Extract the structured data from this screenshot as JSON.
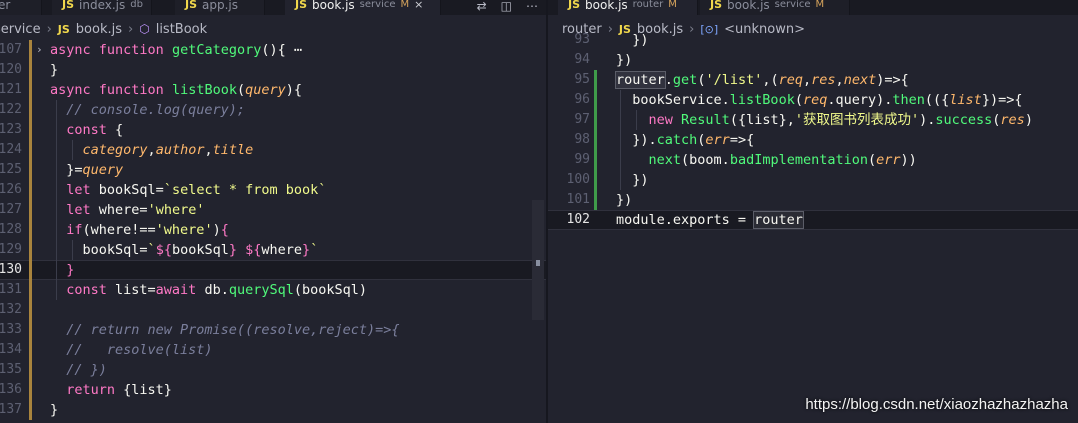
{
  "left_pane": {
    "tabs": [
      {
        "icon": "",
        "name": "er",
        "desc": "",
        "mod": ""
      },
      {
        "icon": "JS",
        "name": "index.js",
        "desc": "db",
        "mod": ""
      },
      {
        "icon": "JS",
        "name": "app.js",
        "desc": "",
        "mod": ""
      },
      {
        "icon": "JS",
        "name": "book.js",
        "desc": "service",
        "mod": "M"
      }
    ],
    "close_glyph": "×",
    "actions": [
      "⇄",
      "◫",
      "⋯"
    ],
    "breadcrumb": {
      "folder": "service",
      "js": "JS",
      "file": "book.js",
      "symbol": "listBook"
    },
    "lines": [
      {
        "num": "107",
        "parts": [
          [
            "kw",
            "async "
          ],
          [
            "kw",
            "function "
          ],
          [
            "fn",
            "getCategory"
          ],
          [
            "pl",
            "(){ "
          ],
          [
            "pl",
            "⋯"
          ]
        ]
      },
      {
        "num": "120",
        "parts": [
          [
            "pl",
            "}"
          ]
        ]
      },
      {
        "num": "121",
        "parts": [
          [
            "kw",
            "async "
          ],
          [
            "kw",
            "function "
          ],
          [
            "fn",
            "listBook"
          ],
          [
            "pl",
            "("
          ],
          [
            "prm",
            "query"
          ],
          [
            "pl",
            "){"
          ]
        ]
      },
      {
        "num": "122",
        "parts": [
          [
            "cm",
            "  // console.log(query);"
          ]
        ]
      },
      {
        "num": "123",
        "parts": [
          [
            "kw",
            "  const "
          ],
          [
            "pl",
            "{"
          ]
        ]
      },
      {
        "num": "124",
        "parts": [
          [
            "prm",
            "    category"
          ],
          [
            "pl",
            ","
          ],
          [
            "prm",
            "author"
          ],
          [
            "pl",
            ","
          ],
          [
            "prm",
            "title"
          ]
        ]
      },
      {
        "num": "125",
        "parts": [
          [
            "pl",
            "  }="
          ],
          [
            "prm",
            "query"
          ]
        ]
      },
      {
        "num": "126",
        "parts": [
          [
            "kw",
            "  let "
          ],
          [
            "pl",
            "bookSql="
          ],
          [
            "str",
            "`select * from book`"
          ]
        ]
      },
      {
        "num": "127",
        "parts": [
          [
            "kw",
            "  let "
          ],
          [
            "pl",
            "where="
          ],
          [
            "str",
            "'where'"
          ]
        ]
      },
      {
        "num": "128",
        "parts": [
          [
            "kw",
            "  if"
          ],
          [
            "pl",
            "(where!=="
          ],
          [
            "str",
            "'where'"
          ],
          [
            "pl",
            ")"
          ],
          [
            "kw",
            "{"
          ]
        ]
      },
      {
        "num": "129",
        "parts": [
          [
            "pl",
            "    bookSql="
          ],
          [
            "str",
            "`"
          ],
          [
            "kw",
            "${"
          ],
          [
            "pl",
            "bookSql"
          ],
          [
            "kw",
            "}"
          ],
          [
            "str",
            " "
          ],
          [
            "kw",
            "${"
          ],
          [
            "pl",
            "where"
          ],
          [
            "kw",
            "}"
          ],
          [
            "str",
            "`"
          ]
        ]
      },
      {
        "num": "130",
        "parts": [
          [
            "kw",
            "  }"
          ]
        ]
      },
      {
        "num": "131",
        "parts": [
          [
            "kw",
            "  const "
          ],
          [
            "pl",
            "list="
          ],
          [
            "kw",
            "await "
          ],
          [
            "pl",
            "db."
          ],
          [
            "fn",
            "querySql"
          ],
          [
            "pl",
            "(bookSql)"
          ]
        ]
      },
      {
        "num": "132",
        "parts": []
      },
      {
        "num": "133",
        "parts": [
          [
            "cm",
            "  // return new Promise((resolve,reject)=>{"
          ]
        ]
      },
      {
        "num": "134",
        "parts": [
          [
            "cm",
            "  //   resolve(list)"
          ]
        ]
      },
      {
        "num": "135",
        "parts": [
          [
            "cm",
            "  // })"
          ]
        ]
      },
      {
        "num": "136",
        "parts": [
          [
            "kw",
            "  return "
          ],
          [
            "pl",
            "{list}"
          ]
        ]
      },
      {
        "num": "137",
        "parts": [
          [
            "pl",
            "}"
          ]
        ]
      }
    ]
  },
  "right_pane": {
    "tabs": [
      {
        "icon": "JS",
        "name": "book.js",
        "desc": "router",
        "mod": "M"
      },
      {
        "icon": "JS",
        "name": "book.js",
        "desc": "service",
        "mod": "M"
      }
    ],
    "breadcrumb": {
      "folder": "router",
      "js": "JS",
      "file": "book.js",
      "symbol": "<unknown>"
    },
    "lines": [
      {
        "num": "93",
        "parts": [
          [
            "pl",
            "  })"
          ]
        ]
      },
      {
        "num": "94",
        "parts": [
          [
            "pl",
            "})"
          ]
        ]
      },
      {
        "num": "95",
        "parts": [
          [
            "sel",
            "router"
          ],
          [
            "pl",
            "."
          ],
          [
            "fn",
            "get"
          ],
          [
            "pl",
            "("
          ],
          [
            "str",
            "'/list'"
          ],
          [
            "pl",
            ",("
          ],
          [
            "prm",
            "req"
          ],
          [
            "pl",
            ","
          ],
          [
            "prm",
            "res"
          ],
          [
            "pl",
            ","
          ],
          [
            "prm",
            "next"
          ],
          [
            "pl",
            ")=>{"
          ]
        ]
      },
      {
        "num": "96",
        "parts": [
          [
            "pl",
            "  bookService."
          ],
          [
            "fn",
            "listBook"
          ],
          [
            "pl",
            "("
          ],
          [
            "prm",
            "req"
          ],
          [
            "pl",
            ".query)."
          ],
          [
            "fn",
            "then"
          ],
          [
            "pl",
            "(({"
          ],
          [
            "prm",
            "list"
          ],
          [
            "pl",
            "})=>{"
          ]
        ]
      },
      {
        "num": "97",
        "parts": [
          [
            "kw",
            "    new "
          ],
          [
            "fn",
            "Result"
          ],
          [
            "pl",
            "({list},"
          ],
          [
            "str",
            "'获取图书列表成功'"
          ],
          [
            "pl",
            ")."
          ],
          [
            "fn",
            "success"
          ],
          [
            "pl",
            "("
          ],
          [
            "prm",
            "res"
          ],
          [
            "pl",
            ")"
          ]
        ]
      },
      {
        "num": "98",
        "parts": [
          [
            "pl",
            "  })."
          ],
          [
            "fn",
            "catch"
          ],
          [
            "pl",
            "("
          ],
          [
            "prm",
            "err"
          ],
          [
            "pl",
            "=>{"
          ]
        ]
      },
      {
        "num": "99",
        "parts": [
          [
            "fn",
            "    next"
          ],
          [
            "pl",
            "(boom."
          ],
          [
            "fn",
            "badImplementation"
          ],
          [
            "pl",
            "("
          ],
          [
            "prm",
            "err"
          ],
          [
            "pl",
            "))"
          ]
        ]
      },
      {
        "num": "100",
        "parts": [
          [
            "pl",
            "  })"
          ]
        ]
      },
      {
        "num": "101",
        "parts": [
          [
            "pl",
            "})"
          ]
        ]
      },
      {
        "num": "102",
        "parts": [
          [
            "pl",
            "module.exports = "
          ],
          [
            "sel",
            "router"
          ]
        ]
      }
    ]
  },
  "watermark": "https://blog.csdn.net/xiaozhazhazhazha"
}
